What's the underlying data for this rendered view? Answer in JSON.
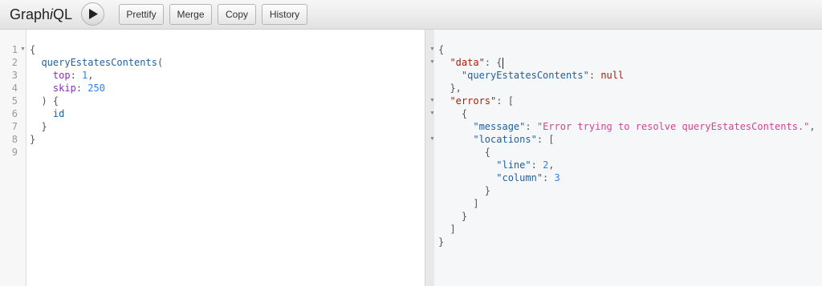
{
  "app": {
    "title_prefix": "Graph",
    "title_italic": "i",
    "title_suffix": "QL"
  },
  "toolbar": {
    "run_icon": "play-icon",
    "buttons": [
      {
        "label": "Prettify"
      },
      {
        "label": "Merge"
      },
      {
        "label": "Copy"
      },
      {
        "label": "History"
      }
    ]
  },
  "editor": {
    "line_numbers": [
      "1",
      "2",
      "3",
      "4",
      "5",
      "6",
      "7",
      "8",
      "9"
    ],
    "lines": {
      "l1": "{",
      "l2_field": "queryEstatesContents",
      "l2_paren": "(",
      "l3_arg": "top",
      "l3_val": "1",
      "l4_arg": "skip",
      "l4_val": "250",
      "l5": ") {",
      "l6": "id",
      "l7": "}",
      "l8": "}"
    }
  },
  "result": {
    "data_key": "\"data\"",
    "query_key": "\"queryEstatesContents\"",
    "query_val": "null",
    "errors_key": "\"errors\"",
    "message_key": "\"message\"",
    "message_val": "\"Error trying to resolve queryEstatesContents.\"",
    "locations_key": "\"locations\"",
    "line_key": "\"line\"",
    "line_val": "2",
    "column_key": "\"column\"",
    "column_val": "3"
  }
}
